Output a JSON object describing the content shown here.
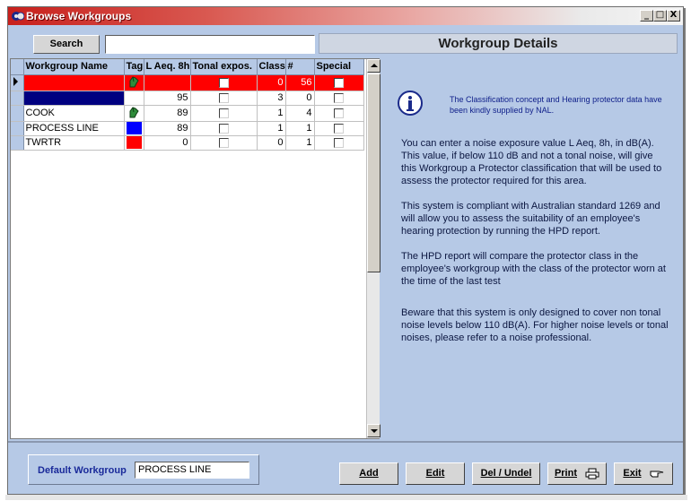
{
  "window": {
    "title": "Browse Workgroups",
    "controls": {
      "minimize": "_",
      "maximize": "□",
      "close": "X"
    }
  },
  "search": {
    "button_label": "Search",
    "input_value": ""
  },
  "details_header": "Workgroup Details",
  "grid": {
    "columns": [
      "Workgroup Name",
      "Tag",
      "L Aeq. 8h",
      "Tonal expos.",
      "Class",
      "#",
      "Special"
    ],
    "rows": [
      {
        "name": "",
        "tag": "hand-icon",
        "laeq": "",
        "tonal": false,
        "class": "0",
        "count": "56",
        "special": false,
        "current": true
      },
      {
        "name": "",
        "tag": "",
        "laeq": "95",
        "tonal": false,
        "class": "3",
        "count": "0",
        "special": false,
        "name_color": "#000080"
      },
      {
        "name": "COOK",
        "tag": "hand-icon",
        "laeq": "89",
        "tonal": false,
        "class": "1",
        "count": "4",
        "special": false
      },
      {
        "name": "PROCESS LINE",
        "tag": "swatch",
        "tag_color": "#0000ff",
        "laeq": "89",
        "tonal": false,
        "class": "1",
        "count": "1",
        "special": false
      },
      {
        "name": "TWRTR",
        "tag": "swatch",
        "tag_color": "#ff0000",
        "laeq": "0",
        "tonal": false,
        "class": "0",
        "count": "1",
        "special": false
      }
    ]
  },
  "info": {
    "note": "The Classification concept and Hearing protector data have been kindly supplied by NAL.",
    "paragraphs": [
      "You can enter a noise exposure value L Aeq, 8h, in dB(A). This value, if below 110 dB and not a tonal noise, will give this Workgroup a Protector classification that will be used to assess the protector required for this area.",
      "This system is compliant with Australian standard 1269 and will allow you to assess the suitability of an employee's hearing protection by running the HPD report.",
      "The HPD report will compare the protector class in the employee's workgroup with the class of the protector worn at the time of the last test",
      "Beware that this system is only designed to cover non tonal noise levels below 110 dB(A).  For higher noise levels or tonal noises, please refer to a noise professional."
    ]
  },
  "default_workgroup": {
    "label": "Default Workgroup",
    "value": "PROCESS LINE"
  },
  "actions": {
    "add": "Add",
    "edit": "Edit",
    "del_undel": "Del / Undel",
    "print": "Print",
    "exit": "Exit"
  },
  "colors": {
    "panel": "#b6c9e6",
    "current_row": "#ff0000",
    "navy": "#000080",
    "title_start": "#c8201c"
  }
}
